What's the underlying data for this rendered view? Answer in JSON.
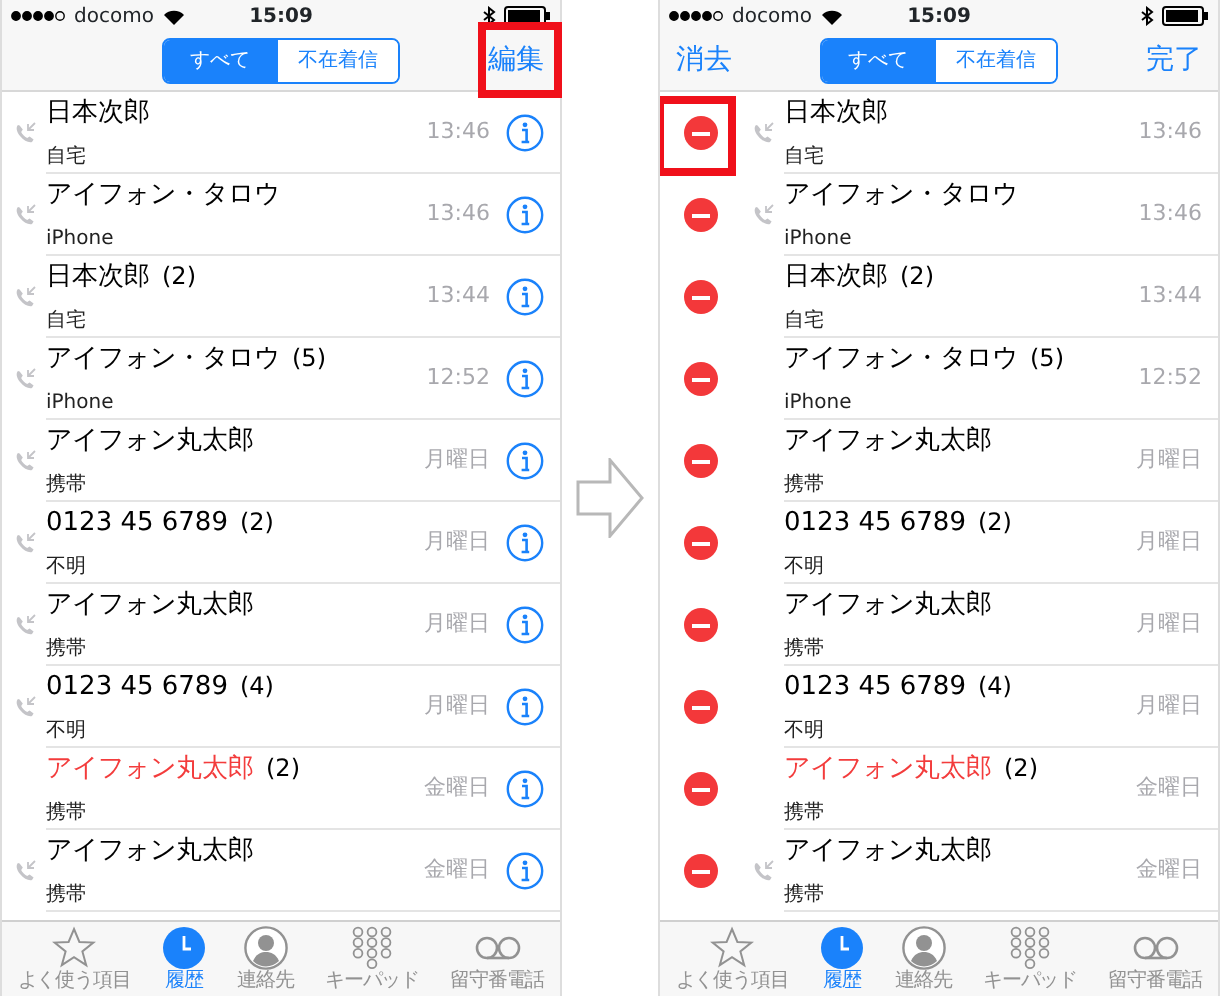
{
  "screens": [
    {
      "status": {
        "carrier": "docomo",
        "time": "15:09"
      },
      "nav": {
        "segments": [
          {
            "label": "すべて",
            "selected": true
          },
          {
            "label": "不在着信",
            "selected": false
          }
        ],
        "right": {
          "label": "編集",
          "highlighted": true
        }
      },
      "editing": false,
      "rows": [
        {
          "name": "日本次郎",
          "type": "自宅",
          "time": "13:46",
          "missed": false,
          "outgoing": true
        },
        {
          "name": "アイフォン・タロウ",
          "type": "iPhone",
          "time": "13:46",
          "missed": false,
          "outgoing": true
        },
        {
          "name": "日本次郎",
          "count": "(2)",
          "type": "自宅",
          "time": "13:44",
          "missed": false,
          "outgoing": true
        },
        {
          "name": "アイフォン・タロウ",
          "count": "(5)",
          "type": "iPhone",
          "time": "12:52",
          "missed": false,
          "outgoing": true
        },
        {
          "name": "アイフォン丸太郎",
          "type": "携帯",
          "time": "月曜日",
          "missed": false,
          "outgoing": true
        },
        {
          "name": "0123 45 6789",
          "count": "(2)",
          "type": "不明",
          "time": "月曜日",
          "missed": false,
          "outgoing": true
        },
        {
          "name": "アイフォン丸太郎",
          "type": "携帯",
          "time": "月曜日",
          "missed": false,
          "outgoing": true
        },
        {
          "name": "0123 45 6789",
          "count": "(4)",
          "type": "不明",
          "time": "月曜日",
          "missed": false,
          "outgoing": true
        },
        {
          "name": "アイフォン丸太郎",
          "count": "(2)",
          "type": "携帯",
          "time": "金曜日",
          "missed": true,
          "outgoing": false
        },
        {
          "name": "アイフォン丸太郎",
          "type": "携帯",
          "time": "金曜日",
          "missed": false,
          "outgoing": true
        }
      ],
      "tabs": [
        {
          "kind": "star",
          "label": "よく使う項目",
          "selected": false
        },
        {
          "kind": "clock",
          "label": "履歴",
          "selected": true
        },
        {
          "kind": "contact",
          "label": "連絡先",
          "selected": false
        },
        {
          "kind": "keypad",
          "label": "キーパッド",
          "selected": false
        },
        {
          "kind": "voicemail",
          "label": "留守番電話",
          "selected": false
        }
      ]
    },
    {
      "status": {
        "carrier": "docomo",
        "time": "15:09"
      },
      "nav": {
        "left": {
          "label": "消去"
        },
        "segments": [
          {
            "label": "すべて",
            "selected": true
          },
          {
            "label": "不在着信",
            "selected": false
          }
        ],
        "right": {
          "label": "完了"
        }
      },
      "editing": true,
      "rows": [
        {
          "name": "日本次郎",
          "type": "自宅",
          "time": "13:46",
          "missed": false,
          "outgoing": true,
          "highlighted": true
        },
        {
          "name": "アイフォン・タロウ",
          "type": "iPhone",
          "time": "13:46",
          "missed": false,
          "outgoing": true
        },
        {
          "name": "日本次郎",
          "count": "(2)",
          "type": "自宅",
          "time": "13:44",
          "missed": false,
          "outgoing": false
        },
        {
          "name": "アイフォン・タロウ",
          "count": "(5)",
          "type": "iPhone",
          "time": "12:52",
          "missed": false,
          "outgoing": false
        },
        {
          "name": "アイフォン丸太郎",
          "type": "携帯",
          "time": "月曜日",
          "missed": false,
          "outgoing": false
        },
        {
          "name": "0123 45 6789",
          "count": "(2)",
          "type": "不明",
          "time": "月曜日",
          "missed": false,
          "outgoing": false
        },
        {
          "name": "アイフォン丸太郎",
          "type": "携帯",
          "time": "月曜日",
          "missed": false,
          "outgoing": false
        },
        {
          "name": "0123 45 6789",
          "count": "(4)",
          "type": "不明",
          "time": "月曜日",
          "missed": false,
          "outgoing": false
        },
        {
          "name": "アイフォン丸太郎",
          "count": "(2)",
          "type": "携帯",
          "time": "金曜日",
          "missed": true,
          "outgoing": false
        },
        {
          "name": "アイフォン丸太郎",
          "type": "携帯",
          "time": "金曜日",
          "missed": false,
          "outgoing": true
        }
      ],
      "tabs": [
        {
          "kind": "star",
          "label": "よく使う項目",
          "selected": false
        },
        {
          "kind": "clock",
          "label": "履歴",
          "selected": true
        },
        {
          "kind": "contact",
          "label": "連絡先",
          "selected": false
        },
        {
          "kind": "keypad",
          "label": "キーパッド",
          "selected": false
        },
        {
          "kind": "voicemail",
          "label": "留守番電話",
          "selected": false
        }
      ]
    }
  ]
}
